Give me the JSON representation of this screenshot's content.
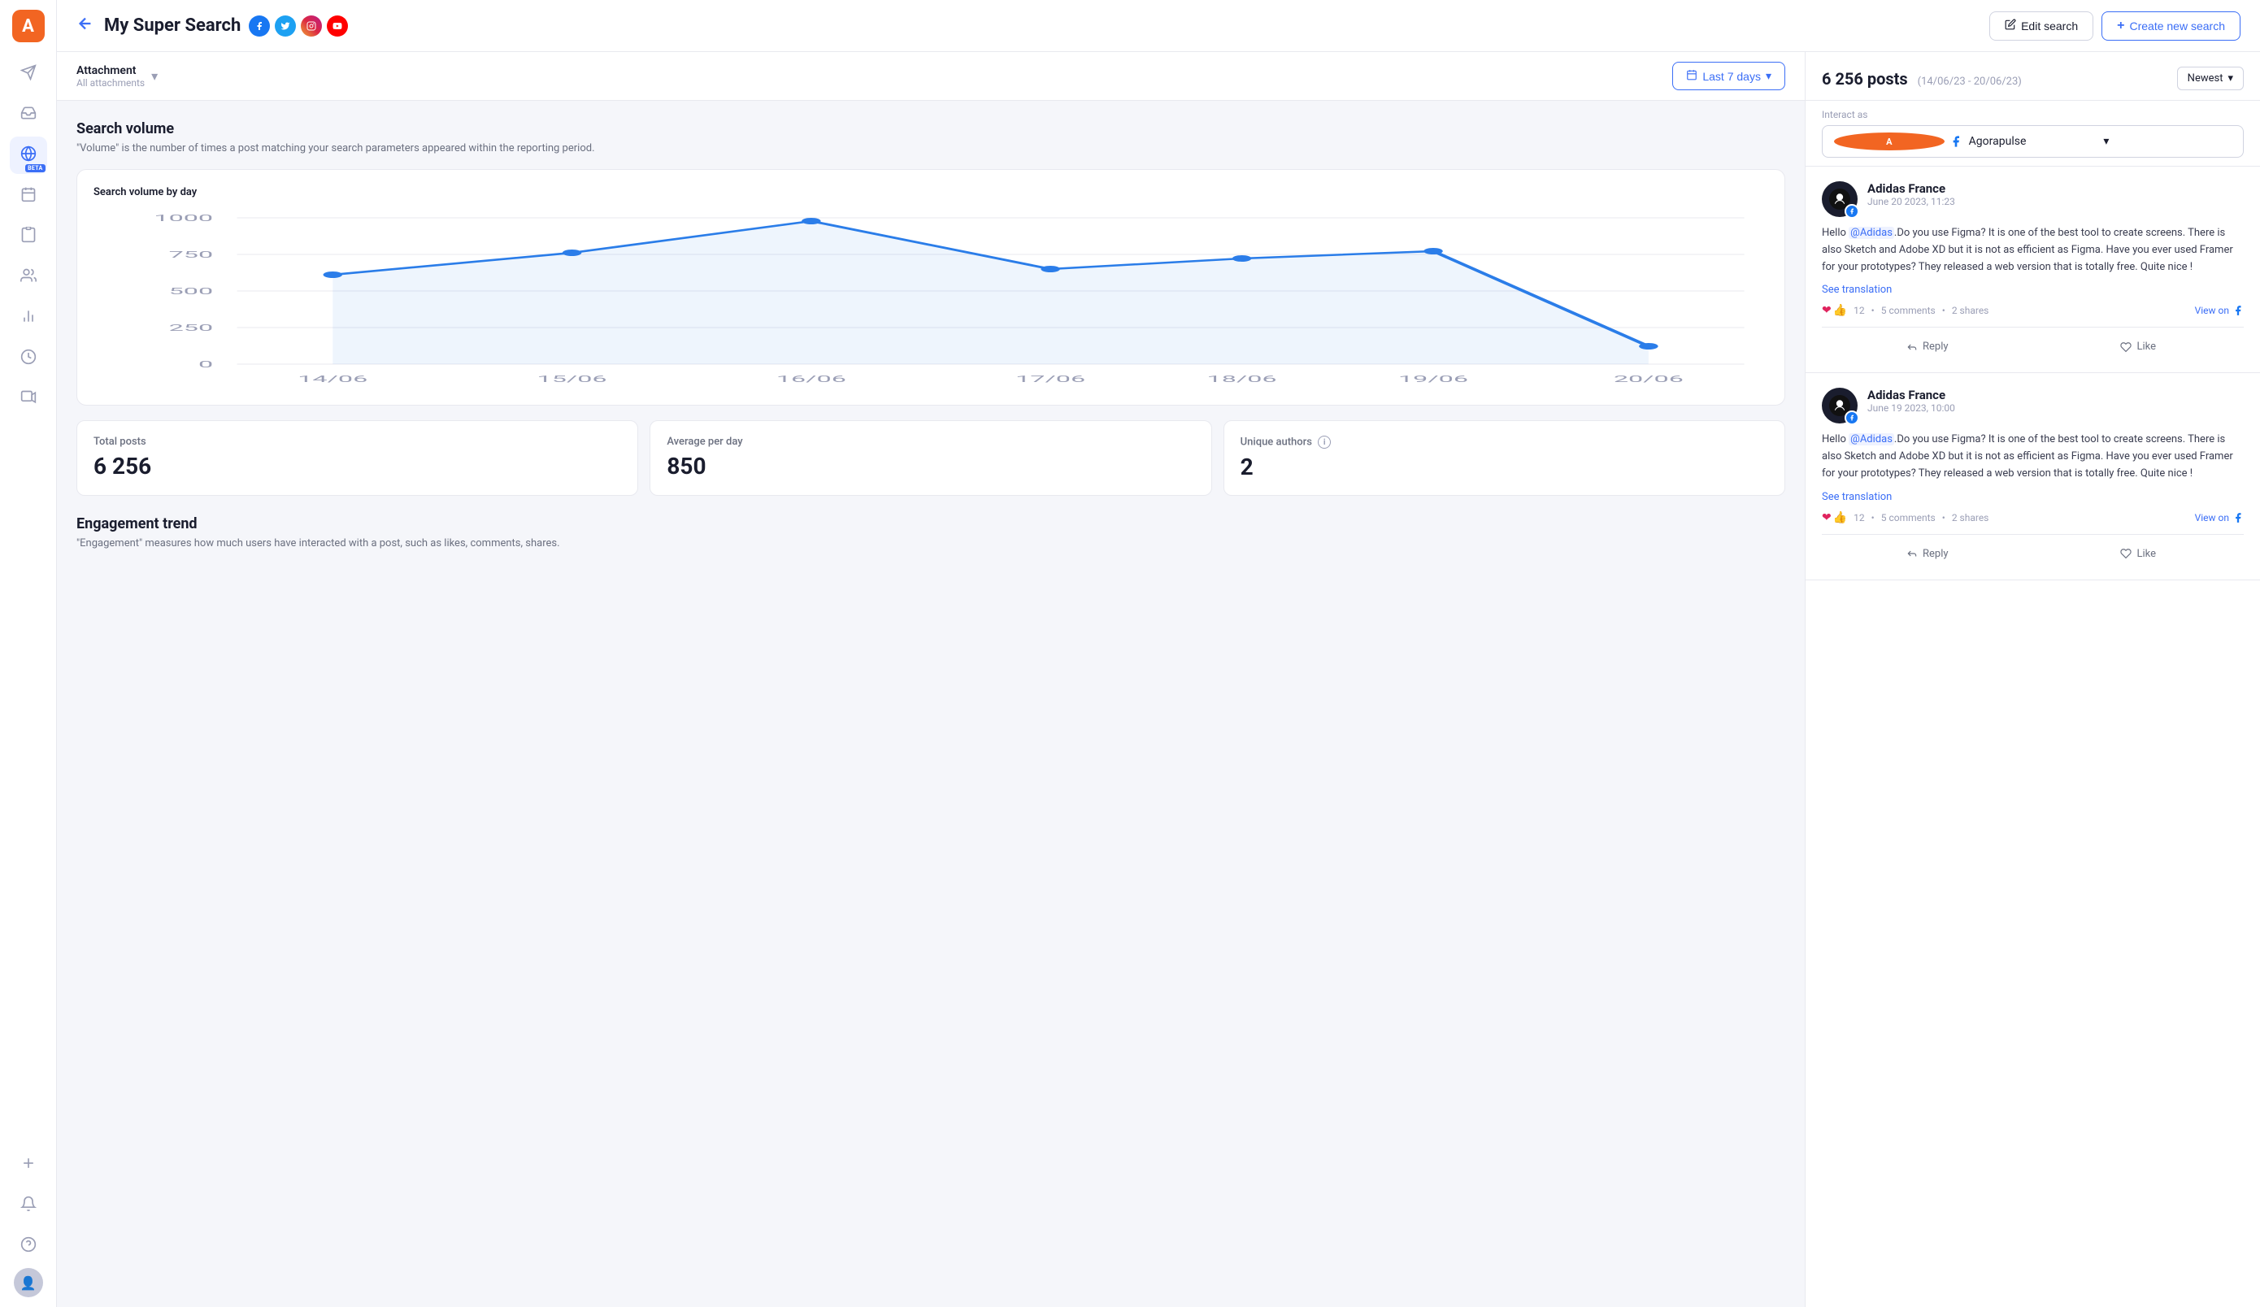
{
  "app": {
    "logo": "A"
  },
  "sidebar": {
    "items": [
      {
        "id": "send",
        "icon": "✉",
        "label": "send-icon"
      },
      {
        "id": "inbox",
        "icon": "⊡",
        "label": "inbox-icon"
      },
      {
        "id": "listen",
        "icon": "🌐",
        "label": "listen-icon",
        "active": true,
        "beta": true
      },
      {
        "id": "calendar",
        "icon": "📅",
        "label": "calendar-icon"
      },
      {
        "id": "reports",
        "icon": "📋",
        "label": "reports-icon"
      },
      {
        "id": "audience",
        "icon": "👥",
        "label": "audience-icon"
      },
      {
        "id": "analytics",
        "icon": "📊",
        "label": "analytics-icon"
      },
      {
        "id": "dashboard",
        "icon": "⊙",
        "label": "dashboard-icon"
      },
      {
        "id": "video",
        "icon": "▶",
        "label": "video-icon"
      },
      {
        "id": "add",
        "icon": "+",
        "label": "add-icon"
      },
      {
        "id": "bell",
        "icon": "🔔",
        "label": "bell-icon"
      },
      {
        "id": "help",
        "icon": "?",
        "label": "help-icon"
      }
    ],
    "beta_label": "BETA"
  },
  "header": {
    "back_label": "←",
    "title": "My Super Search",
    "social_icons": [
      "fb",
      "tw",
      "ig",
      "yt"
    ],
    "edit_label": "Edit search",
    "create_label": "Create new search",
    "edit_icon": "✏",
    "create_icon": "+"
  },
  "filter_bar": {
    "attachment_label": "Attachment",
    "attachment_sub": "All attachments",
    "chevron": "▾",
    "date_icon": "📅",
    "date_label": "Last 7 days",
    "date_chevron": "▾"
  },
  "analytics": {
    "search_volume_title": "Search volume",
    "search_volume_desc": "\"Volume\" is the number of times a post matching your search parameters appeared within the reporting period.",
    "chart_title": "Search volume by day",
    "chart": {
      "labels": [
        "14/06",
        "15/06",
        "16/06",
        "17/06",
        "18/06",
        "19/06",
        "20/06"
      ],
      "values": [
        610,
        760,
        980,
        650,
        720,
        770,
        120
      ],
      "y_ticks": [
        0,
        250,
        500,
        750,
        1000
      ]
    },
    "stats": [
      {
        "label": "Total posts",
        "value": "6 256"
      },
      {
        "label": "Average per day",
        "value": "850"
      },
      {
        "label": "Unique authors",
        "value": "2",
        "info": true
      }
    ],
    "engagement_title": "Engagement trend",
    "engagement_desc": "\"Engagement\" measures how much users have interacted with a post, such as likes, comments, shares."
  },
  "posts": {
    "count": "6 256 posts",
    "date_range": "(14/06/23 - 20/06/23)",
    "sort_label": "Newest",
    "sort_chevron": "▾",
    "interact_label": "Interact as",
    "interact_account": "Agorapulse",
    "interact_chevron": "▾",
    "items": [
      {
        "author": "Adidas France",
        "date": "June 20 2023, 11:23",
        "text_before": "Hello ",
        "mention": "@Adidas",
        "text_after": ".Do you use Figma? It is one of the best tool to create screens. There is also Sketch and Adobe XD but it is not as efficient as Figma. Have you ever used Framer for your prototypes? They released a web version that is totally free. Quite nice !",
        "see_translation": "See translation",
        "reactions": "12",
        "comments": "5 comments",
        "shares": "2 shares",
        "view_on": "View on",
        "reply_label": "Reply",
        "like_label": "Like"
      },
      {
        "author": "Adidas France",
        "date": "June 19 2023, 10:00",
        "text_before": "Hello ",
        "mention": "@Adidas",
        "text_after": ".Do you use Figma? It is one of the best tool to create screens. There is also Sketch and Adobe XD but it is not as efficient as Figma. Have you ever used Framer for your prototypes? They released a web version that is totally free. Quite nice !",
        "see_translation": "See translation",
        "reactions": "12",
        "comments": "5 comments",
        "shares": "2 shares",
        "view_on": "View on",
        "reply_label": "Reply",
        "like_label": "Like"
      }
    ]
  }
}
